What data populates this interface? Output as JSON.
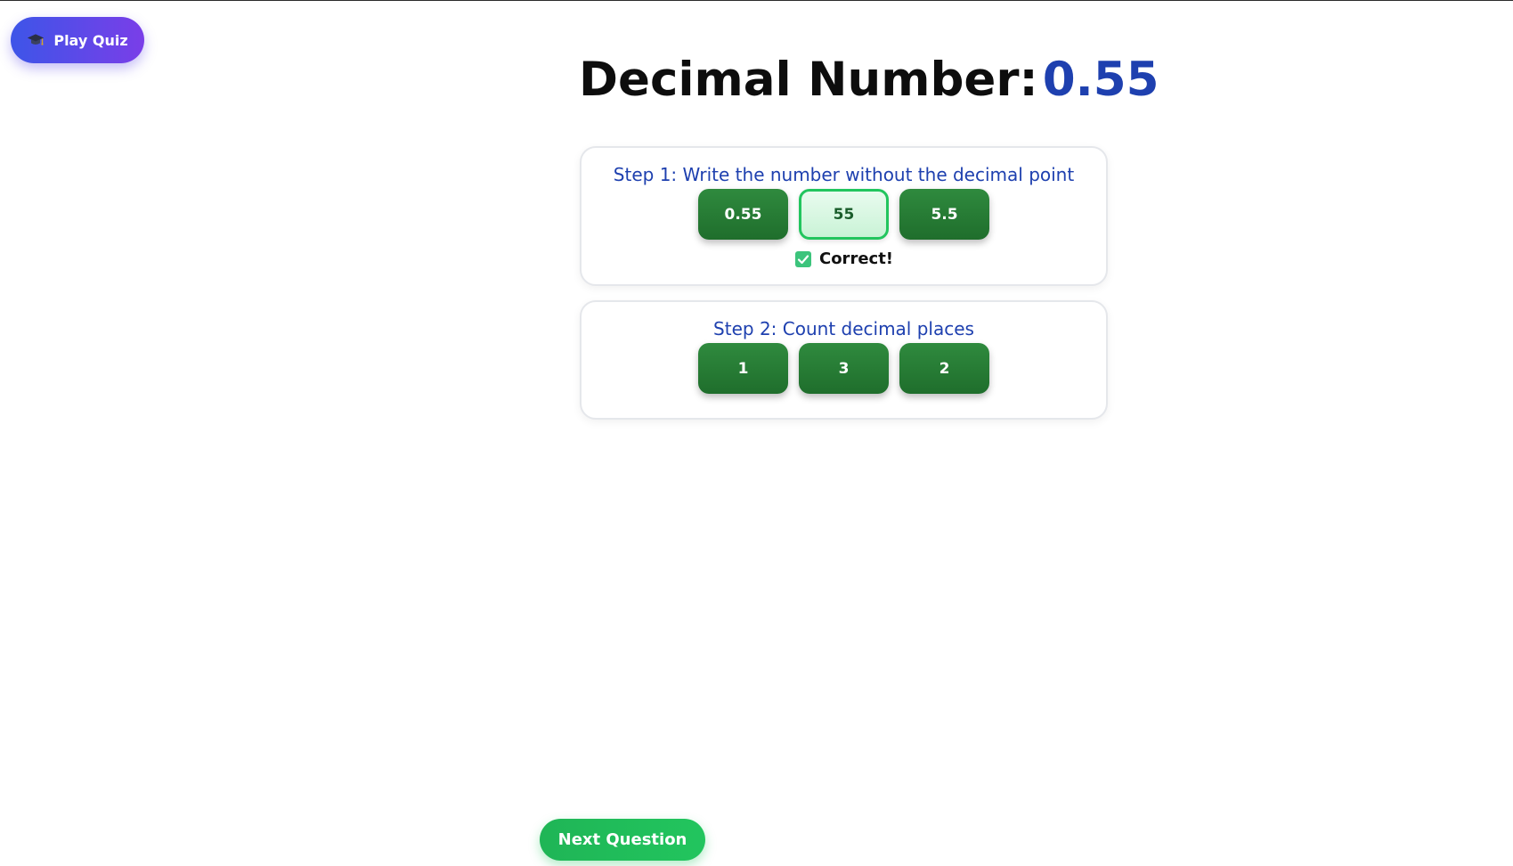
{
  "header": {
    "play_quiz_label": "Play Quiz",
    "play_quiz_icon": "graduation-cap-icon",
    "accent_gradient": [
      "#3d55e8",
      "#7a3ee8"
    ]
  },
  "question": {
    "title_label": "Decimal Number:",
    "title_value": "0.55",
    "value_color": "#1e40af"
  },
  "steps": [
    {
      "title": "Step 1: Write the number without the decimal point",
      "options": [
        "0.55",
        "55",
        "5.5"
      ],
      "selected_index": 1,
      "feedback_icon": "check-box-icon",
      "feedback_text": "Correct!"
    },
    {
      "title": "Step 2: Count decimal places",
      "options": [
        "1",
        "3",
        "2"
      ]
    }
  ],
  "footer": {
    "next_label": "Next Question",
    "next_color": "#22c55e"
  },
  "colors": {
    "option_bg": "#2f8a3e",
    "selected_border": "#22c55e"
  }
}
